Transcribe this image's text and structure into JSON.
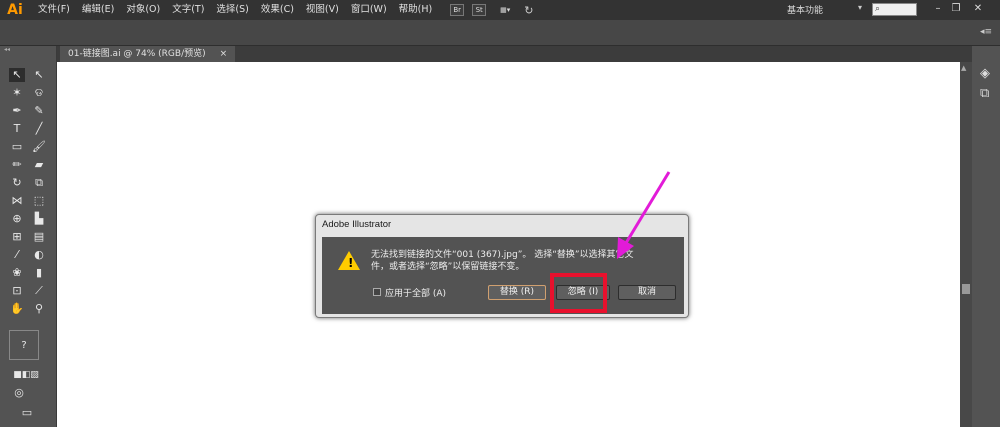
{
  "app": {
    "logo": "Ai"
  },
  "menu": [
    "文件(F)",
    "编辑(E)",
    "对象(O)",
    "文字(T)",
    "选择(S)",
    "效果(C)",
    "视图(V)",
    "窗口(W)",
    "帮助(H)"
  ],
  "menubar_icons": {
    "bridge": "Br",
    "stock": "St",
    "arrange": "▦▾",
    "sync": "sync-icon"
  },
  "workspace": {
    "label": "基本功能",
    "caret": "▾"
  },
  "search": {
    "placeholder": ""
  },
  "window_controls": {
    "minimize": "–",
    "restore": "❐",
    "close": "✕"
  },
  "document_tab": {
    "title": "01-链接图.ai @ 74% (RGB/预览)",
    "close": "×"
  },
  "dialog": {
    "title": "Adobe Illustrator",
    "message_line1": "无法找到链接的文件“001 (367).jpg”。 选择“替换”以选择其它文",
    "message_line2": "件，或者选择“忽略”以保留链接不变。",
    "checkbox_label": "应用于全部 (A)",
    "replace_label": "替换 (R)",
    "ignore_label": "忽略 (I)",
    "cancel_label": "取消"
  },
  "annotation_colors": {
    "arrow": "#e21bd8",
    "highlight": "#e8112d"
  }
}
